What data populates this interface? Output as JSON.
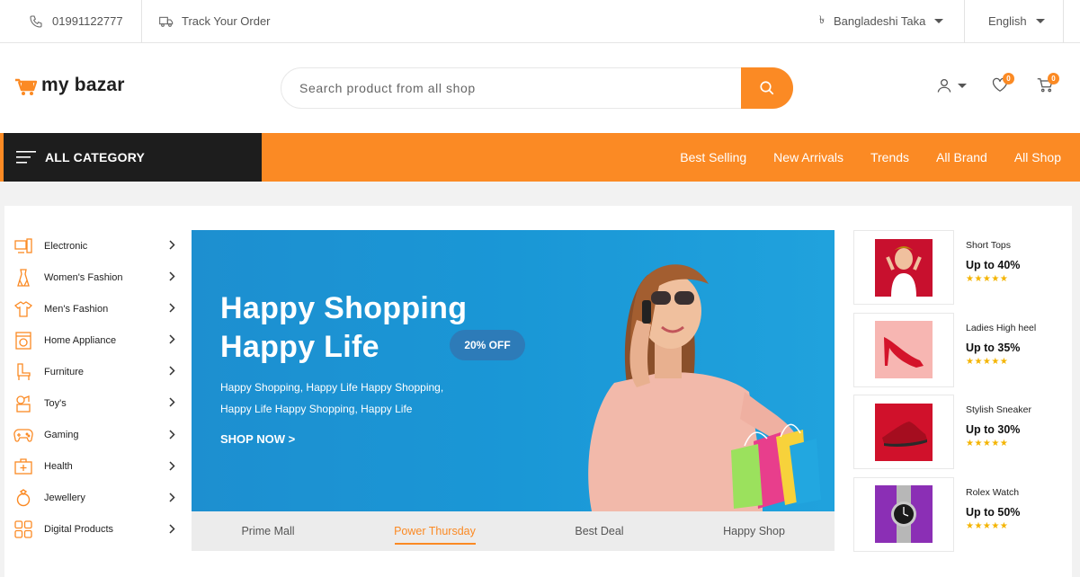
{
  "topbar": {
    "phone": "01991122777",
    "track_order": "Track Your Order",
    "currency": "Bangladeshi Taka",
    "currency_symbol": "৳",
    "language": "English"
  },
  "header": {
    "logo_part1": "my ",
    "logo_part2": "bazar",
    "search_placeholder": "Search product from all shop",
    "wishlist_count": "0",
    "cart_count": "0"
  },
  "nav": {
    "all_category": "ALL CATEGORY",
    "links": [
      "Best Selling",
      "New Arrivals",
      "Trends",
      "All Brand",
      "All Shop"
    ]
  },
  "categories": [
    {
      "label": "Electronic",
      "icon": "electronic-icon"
    },
    {
      "label": "Women's Fashion",
      "icon": "dress-icon"
    },
    {
      "label": "Men's Fashion",
      "icon": "shirt-icon"
    },
    {
      "label": "Home Appliance",
      "icon": "washing-machine-icon"
    },
    {
      "label": "Furniture",
      "icon": "chair-icon"
    },
    {
      "label": "Toy's",
      "icon": "toy-icon"
    },
    {
      "label": "Gaming",
      "icon": "gamepad-icon"
    },
    {
      "label": "Health",
      "icon": "first-aid-icon"
    },
    {
      "label": "Jewellery",
      "icon": "ring-icon"
    },
    {
      "label": "Digital Products",
      "icon": "grid-icon"
    }
  ],
  "banner": {
    "title_line1": "Happy Shopping",
    "title_line2": "Happy Life",
    "discount": "20% OFF",
    "subtitle": "Happy Shopping, Happy Life Happy Shopping, Happy Life Happy Shopping, Happy Life",
    "cta": "SHOP NOW >"
  },
  "tabs": [
    "Prime Mall",
    "Power Thursday",
    "Best Deal",
    "Happy Shop"
  ],
  "active_tab": "Power Thursday",
  "side_promos": [
    {
      "name": "Short Tops",
      "deal": "Up to 40%",
      "rating": "★★★★★"
    },
    {
      "name": "Ladies High heel",
      "deal": "Up to 35%",
      "rating": "★★★★★"
    },
    {
      "name": "Stylish Sneaker",
      "deal": "Up to 30%",
      "rating": "★★★★★"
    },
    {
      "name": "Rolex Watch",
      "deal": "Up to 50%",
      "rating": "★★★★★"
    }
  ],
  "colors": {
    "accent": "#fb8a24",
    "dark": "#1d1d1d",
    "banner": "#1a97d6",
    "star": "#f4b400"
  }
}
